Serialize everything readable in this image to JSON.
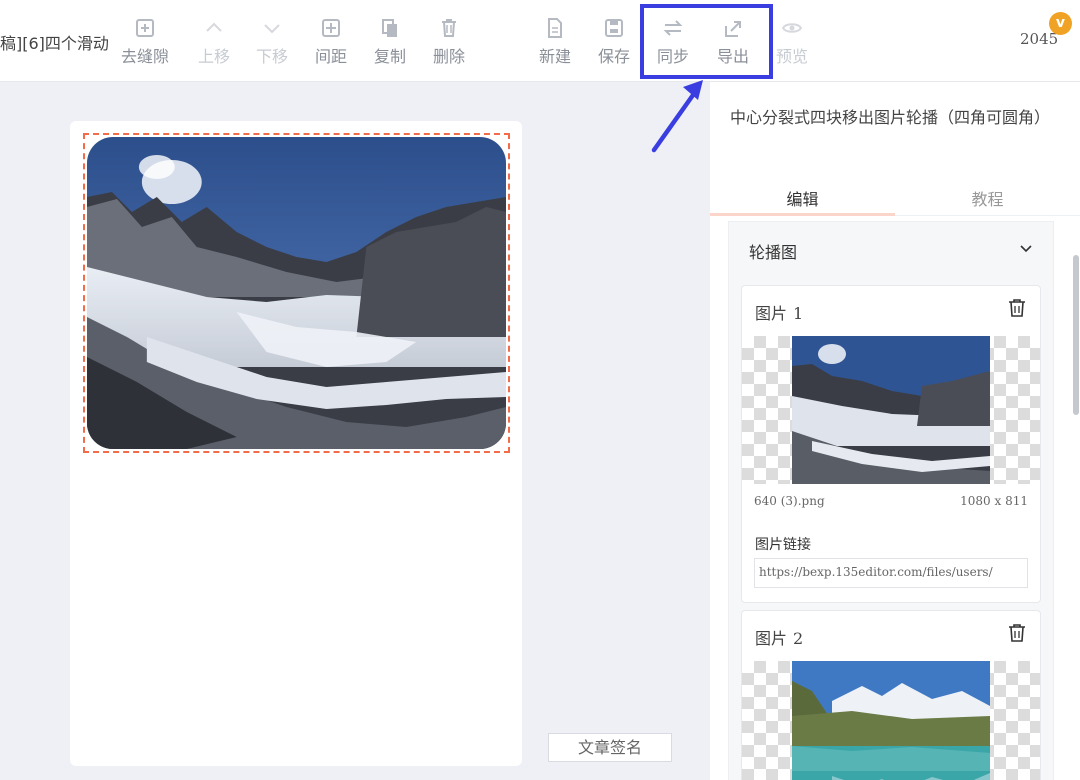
{
  "toolbar": {
    "doc_title": "稿][6]四个滑动",
    "buttons": [
      {
        "label": "去缝隙",
        "icon": "plus-box-icon"
      },
      {
        "label": "上移",
        "icon": "chevron-up-icon"
      },
      {
        "label": "下移",
        "icon": "chevron-down-icon"
      },
      {
        "label": "间距",
        "icon": "spacing-icon"
      },
      {
        "label": "复制",
        "icon": "copy-icon"
      },
      {
        "label": "删除",
        "icon": "trash-icon"
      },
      {
        "label": "新建",
        "icon": "new-file-icon"
      },
      {
        "label": "保存",
        "icon": "save-icon"
      },
      {
        "label": "同步",
        "icon": "sync-arrows-icon"
      },
      {
        "label": "导出",
        "icon": "export-icon"
      },
      {
        "label": "预览",
        "icon": "eye-icon"
      }
    ],
    "count": "2045",
    "badge": "v"
  },
  "canvas": {
    "sign_button": "文章签名"
  },
  "panel": {
    "title": "中心分裂式四块移出图片轮播（四角可圆角）",
    "tabs": [
      {
        "label": "编辑",
        "active": true
      },
      {
        "label": "教程",
        "active": false
      }
    ],
    "section_title": "轮播图",
    "cards": [
      {
        "title": "图片",
        "number": "1",
        "filename": "640 (3).png",
        "dimensions": "1080 x 811",
        "link_label": "图片链接",
        "link_value": "https://bexp.135editor.com/files/users/"
      },
      {
        "title": "图片",
        "number": "2"
      }
    ]
  },
  "colors": {
    "highlight": "#3a3ee0",
    "dashed_border": "#f36c4a",
    "badge": "#f0a225",
    "tab_underline": "#fbd5ca"
  }
}
